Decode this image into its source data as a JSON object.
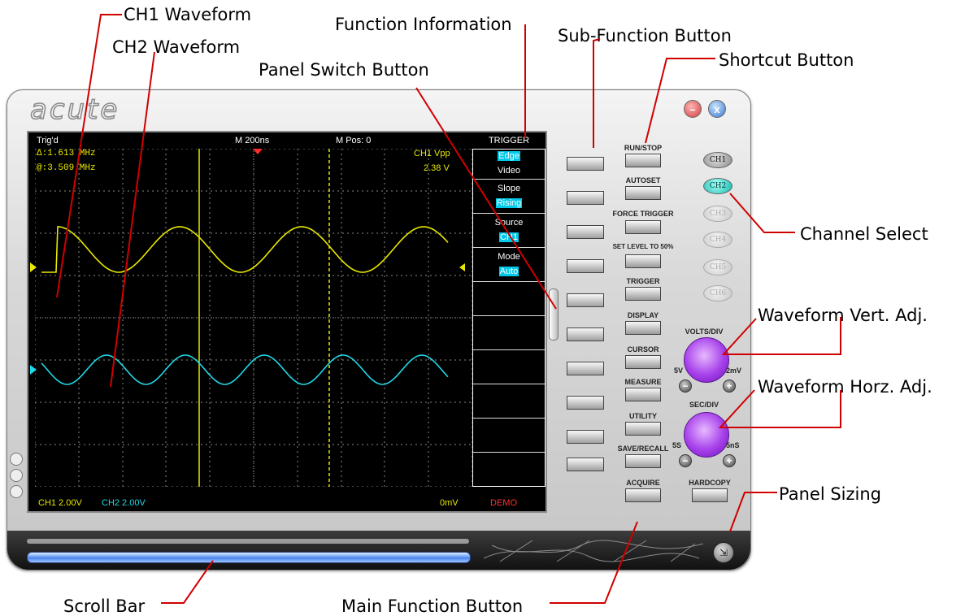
{
  "callouts": {
    "ch1_waveform": "CH1 Waveform",
    "ch2_waveform": "CH2 Waveform",
    "function_information": "Function Information",
    "sub_function_button": "Sub-Function Button",
    "shortcut_button": "Shortcut Button",
    "panel_switch_button": "Panel Switch Button",
    "channel_select": "Channel Select",
    "waveform_vert_adj": "Waveform Vert. Adj.",
    "waveform_horz_adj": "Waveform Horz. Adj.",
    "panel_sizing": "Panel Sizing",
    "scroll_bar": "Scroll Bar",
    "main_function_button": "Main Function Button"
  },
  "window": {
    "logo": "acute",
    "minimize_glyph": "–",
    "close_glyph": "x"
  },
  "screen": {
    "status": "Trig'd",
    "timebase": "M 200ns",
    "mpos": "M Pos: 0",
    "delta": "Δ:1.613 MHz",
    "at": "@:3.509 MHz",
    "meas_label": "CH1 Vpp",
    "meas_value": "2.38 V",
    "ch1_scale": "CH1  2.00V",
    "ch2_scale": "CH2  2.00V",
    "offset": "0mV",
    "demo": "DEMO"
  },
  "trigger_menu": {
    "title": "TRIGGER",
    "items": [
      {
        "label": "Edge",
        "highlighted": true
      },
      {
        "label": "Video",
        "highlighted": false
      },
      {
        "label": "Slope",
        "highlighted": false
      },
      {
        "label": "Rising",
        "highlighted": true
      },
      {
        "label": "Source",
        "highlighted": false
      },
      {
        "label": "CH1",
        "highlighted": true
      },
      {
        "label": "Mode",
        "highlighted": false
      },
      {
        "label": "Auto",
        "highlighted": true
      }
    ]
  },
  "shortcuts": {
    "run_stop": "RUN/STOP",
    "autoset": "AUTOSET",
    "force_trigger": "FORCE TRIGGER",
    "set_level": "SET LEVEL TO 50%"
  },
  "main_functions": {
    "trigger": "TRIGGER",
    "display": "DISPLAY",
    "cursor": "CURSOR",
    "measure": "MEASURE",
    "utility": "UTILITY",
    "save_recall": "SAVE/RECALL",
    "acquire": "ACQUIRE",
    "hardcopy": "HARDCOPY"
  },
  "channels": [
    {
      "label": "CH1",
      "state": "on"
    },
    {
      "label": "CH2",
      "state": "selected"
    },
    {
      "label": "CH3",
      "state": "off"
    },
    {
      "label": "CH4",
      "state": "off"
    },
    {
      "label": "CH5",
      "state": "off"
    },
    {
      "label": "CH6",
      "state": "off"
    }
  ],
  "volts_div": {
    "title": "VOLTS/DIV",
    "min": "5V",
    "max": "2mV"
  },
  "sec_div": {
    "title": "SEC/DIV",
    "min": "5S",
    "max": "5nS"
  },
  "colors": {
    "ch1": "#e8e800",
    "ch2": "#20d8e8",
    "highlight": "#00c8e8",
    "knob": "#a640ea"
  },
  "icons": {
    "minimize": "minimize-icon",
    "close": "close-icon",
    "sizing": "resize-icon",
    "plus": "plus-icon",
    "minus": "minus-icon"
  }
}
